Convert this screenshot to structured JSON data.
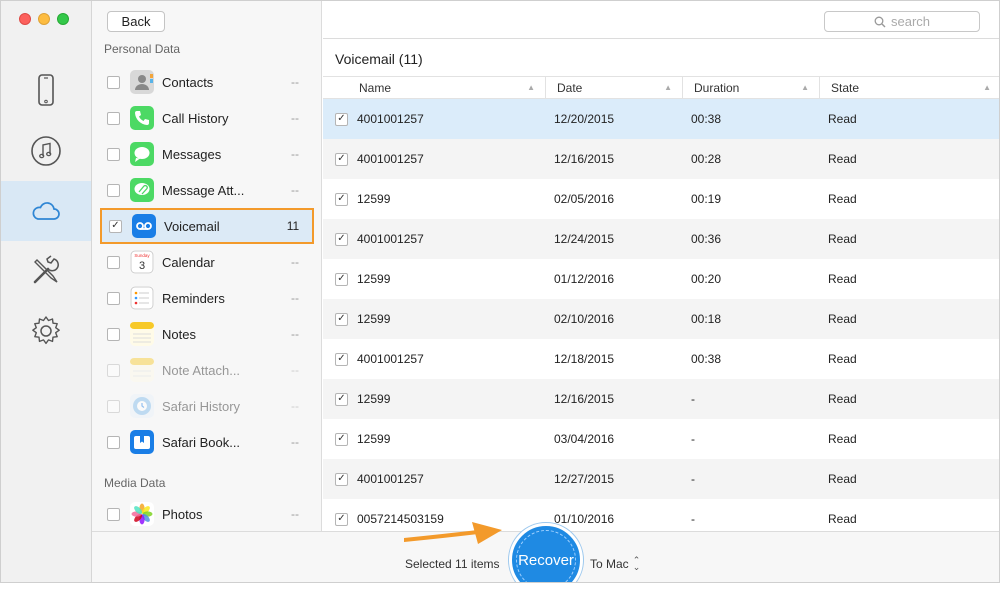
{
  "toolbar": {
    "back_label": "Back",
    "search_placeholder": "search"
  },
  "sidebar": {
    "rail_icons": [
      "iphone-icon",
      "music-icon",
      "icloud-icon",
      "tools-icon",
      "gear-icon"
    ],
    "active_rail": "icloud-icon"
  },
  "categories": {
    "personal_label": "Personal Data",
    "media_label": "Media Data",
    "items": [
      {
        "name": "Contacts",
        "count": "--",
        "icon": "contacts-icon",
        "checked": false,
        "dim": false
      },
      {
        "name": "Call History",
        "count": "--",
        "icon": "phone-icon",
        "checked": false,
        "dim": false
      },
      {
        "name": "Messages",
        "count": "--",
        "icon": "messages-icon",
        "checked": false,
        "dim": false
      },
      {
        "name": "Message Att...",
        "count": "--",
        "icon": "paperclip-icon",
        "checked": false,
        "dim": false
      },
      {
        "name": "Voicemail",
        "count": "11",
        "icon": "voicemail-icon",
        "checked": true,
        "dim": false
      },
      {
        "name": "Calendar",
        "count": "--",
        "icon": "calendar-icon",
        "checked": false,
        "dim": false
      },
      {
        "name": "Reminders",
        "count": "--",
        "icon": "reminders-icon",
        "checked": false,
        "dim": false
      },
      {
        "name": "Notes",
        "count": "--",
        "icon": "notes-icon",
        "checked": false,
        "dim": false
      },
      {
        "name": "Note Attach...",
        "count": "--",
        "icon": "note-attachment-icon",
        "checked": false,
        "dim": true
      },
      {
        "name": "Safari History",
        "count": "--",
        "icon": "safari-history-icon",
        "checked": false,
        "dim": true
      },
      {
        "name": "Safari Book...",
        "count": "--",
        "icon": "safari-bookmark-icon",
        "checked": false,
        "dim": false
      }
    ],
    "media_items": [
      {
        "name": "Photos",
        "count": "--",
        "icon": "photos-icon",
        "checked": false,
        "dim": false
      }
    ]
  },
  "list": {
    "title": "Voicemail (11)",
    "columns": [
      "Name",
      "Date",
      "Duration",
      "State"
    ],
    "rows": [
      {
        "name": "4001001257",
        "date": "12/20/2015",
        "duration": "00:38",
        "state": "Read"
      },
      {
        "name": "4001001257",
        "date": "12/16/2015",
        "duration": "00:28",
        "state": "Read"
      },
      {
        "name": "12599",
        "date": "02/05/2016",
        "duration": "00:19",
        "state": "Read"
      },
      {
        "name": "4001001257",
        "date": "12/24/2015",
        "duration": "00:36",
        "state": "Read"
      },
      {
        "name": "12599",
        "date": "01/12/2016",
        "duration": "00:20",
        "state": "Read"
      },
      {
        "name": "12599",
        "date": "02/10/2016",
        "duration": "00:18",
        "state": "Read"
      },
      {
        "name": "4001001257",
        "date": "12/18/2015",
        "duration": "00:38",
        "state": "Read"
      },
      {
        "name": "12599",
        "date": "12/16/2015",
        "duration": "-",
        "state": "Read"
      },
      {
        "name": "12599",
        "date": "03/04/2016",
        "duration": "-",
        "state": "Read"
      },
      {
        "name": "4001001257",
        "date": "12/27/2015",
        "duration": "-",
        "state": "Read"
      },
      {
        "name": "0057214503159",
        "date": "01/10/2016",
        "duration": "-",
        "state": "Read"
      }
    ]
  },
  "footer": {
    "selected_text": "Selected 11 items",
    "recover_label": "Recover",
    "destination": "To Mac"
  },
  "colors": {
    "accent": "#1f8ae3",
    "highlight": "#f39a2b",
    "selected_row": "#dbecfa"
  }
}
